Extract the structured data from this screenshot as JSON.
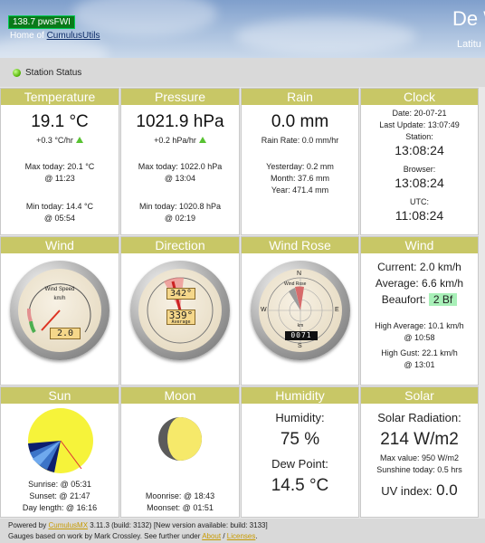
{
  "header": {
    "fwi_badge": "138.7 pwsFWI",
    "home_prefix": "Home of ",
    "home_link": "CumulusUtils",
    "site_title": "De W",
    "site_sub": "Latitu"
  },
  "status": {
    "label": "Station Status"
  },
  "panels": {
    "temperature": {
      "title": "Temperature",
      "value": "19.1 °C",
      "trend": "+0.3 °C/hr",
      "max_label": "Max today: 20.1 °C",
      "max_time": "@ 11:23",
      "min_label": "Min today: 14.4 °C",
      "min_time": "@ 05:54"
    },
    "pressure": {
      "title": "Pressure",
      "value": "1021.9 hPa",
      "trend": "+0.2 hPa/hr",
      "max_label": "Max today: 1022.0 hPa",
      "max_time": "@ 13:04",
      "min_label": "Min today: 1020.8 hPa",
      "min_time": "@ 02:19"
    },
    "rain": {
      "title": "Rain",
      "value": "0.0 mm",
      "rate": "Rain Rate: 0.0 mm/hr",
      "yesterday": "Yesterday: 0.2 mm",
      "month": "Month: 37.6 mm",
      "year": "Year: 471.4 mm"
    },
    "clock": {
      "title": "Clock",
      "date": "Date: 20-07-21",
      "last_update": "Last Update: 13:07:49",
      "station_label": "Station:",
      "station_time": "13:08:24",
      "browser_label": "Browser:",
      "browser_time": "13:08:24",
      "utc_label": "UTC:",
      "utc_time": "11:08:24"
    },
    "wind_gauge": {
      "title": "Wind",
      "dial_label": "Wind Speed",
      "dial_unit": "km/h",
      "lcd": "2.0"
    },
    "direction": {
      "title": "Direction",
      "lcd_top": "342°",
      "lcd_bottom": "339°",
      "lcd_bottom_caption": "Average"
    },
    "wind_rose": {
      "title": "Wind Rose",
      "dial_label": "Wind Rose",
      "odometer": "0071",
      "unit": "km",
      "n": "N",
      "s": "S",
      "e": "E",
      "w": "W"
    },
    "wind_text": {
      "title": "Wind",
      "current": "Current: 2.0 km/h",
      "average": "Average: 6.6 km/h",
      "beaufort_label": "Beaufort:",
      "beaufort_value": "2 Bf",
      "high_avg": "High Average: 10.1 km/h",
      "high_avg_time": "@ 10:58",
      "high_gust": "High Gust: 22.1 km/h",
      "high_gust_time": "@ 13:01"
    },
    "sun": {
      "title": "Sun",
      "sunrise": "Sunrise: @ 05:31",
      "sunset": "Sunset: @ 21:47",
      "day_length": "Day length: @ 16:16"
    },
    "moon": {
      "title": "Moon",
      "moonrise": "Moonrise: @ 18:43",
      "moonset": "Moonset: @ 01:51"
    },
    "humidity": {
      "title": "Humidity",
      "hum_label": "Humidity:",
      "hum_value": "75 %",
      "dew_label": "Dew Point:",
      "dew_value": "14.5 °C"
    },
    "solar": {
      "title": "Solar",
      "rad_label": "Solar Radiation:",
      "rad_value": "214 W/m2",
      "max_value": "Max value: 950 W/m2",
      "sunshine": "Sunshine today: 0.5 hrs",
      "uv_label": "UV index:",
      "uv_value": "0.0"
    }
  },
  "footer": {
    "line1_prefix": "Powered by ",
    "line1_link": "CumulusMX",
    "line1_rest": " 3.11.3 (build: 3132) [New version available: build: 3133]",
    "line2_prefix": "Gauges based on work by Mark Crossley. See further under ",
    "line2_about": "About",
    "line2_sep": " / ",
    "line2_licenses": "Licenses",
    "line2_end": "."
  },
  "colors": {
    "panel_header": "#c8c766",
    "trend_up": "#58c232",
    "beaufort_bg": "#a8f0b8",
    "sun_yellow": "#f5f542",
    "sky_blue": "#5b8fd6"
  }
}
